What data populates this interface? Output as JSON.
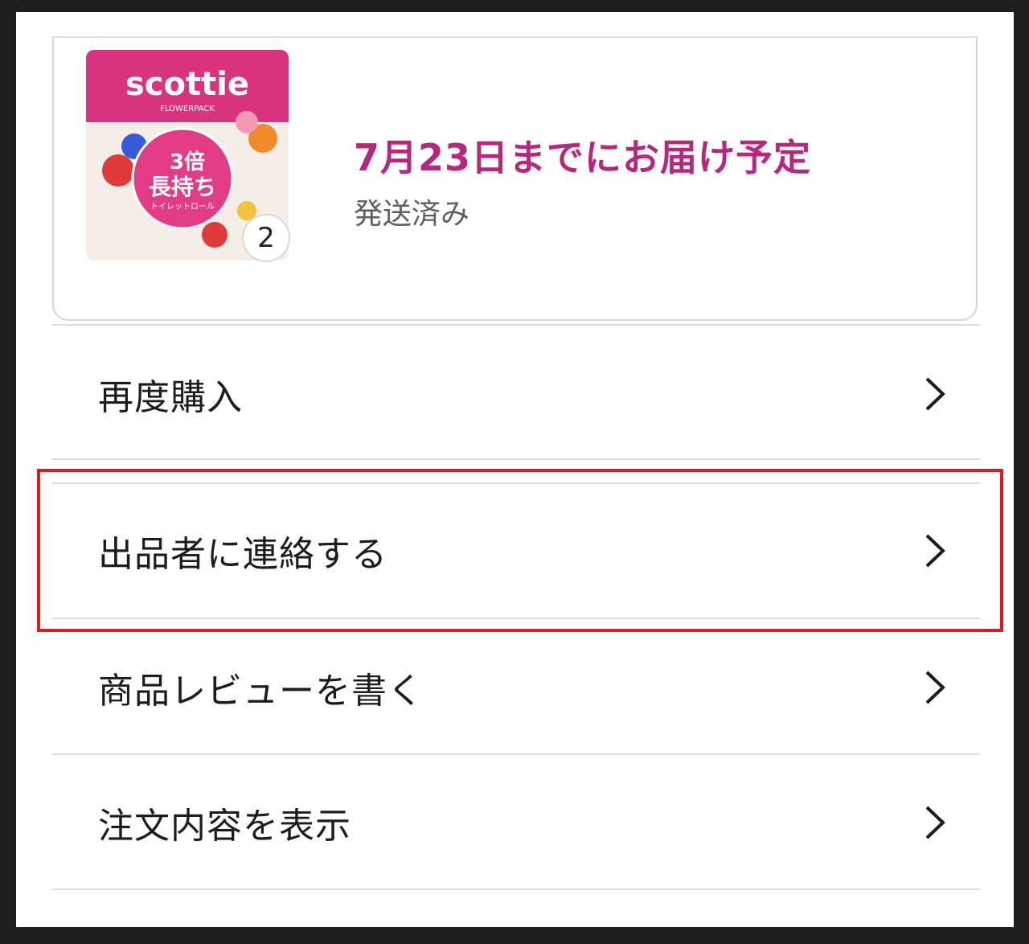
{
  "order": {
    "product_image_alt": "scottie FLOWERPACK toilet roll",
    "product_brand": "scottie",
    "product_sub": "FLOWERPACK",
    "product_badge_line1": "3倍",
    "product_badge_line2": "長持ち",
    "product_badge_line3": "トイレットロール",
    "quantity": "2",
    "delivery_title": "7月23日までにお届け予定",
    "delivery_status": "発送済み"
  },
  "menu": {
    "items": [
      {
        "label": "再度購入"
      },
      {
        "label": "出品者に連絡する"
      },
      {
        "label": "商品レビューを書く"
      },
      {
        "label": "注文内容を表示"
      }
    ]
  },
  "colors": {
    "accent": "#b6287c",
    "highlight": "#e0191f"
  }
}
